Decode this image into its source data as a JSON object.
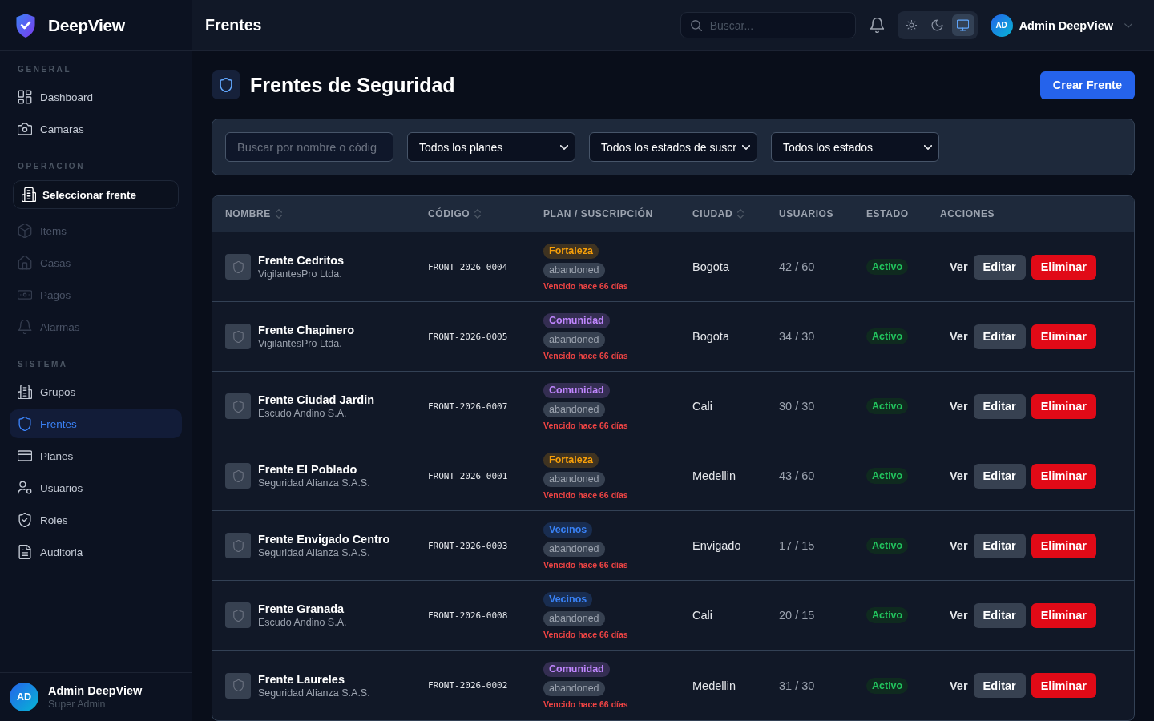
{
  "sidebar": {
    "brand": "DeepView",
    "sections": [
      {
        "title": "GENERAL",
        "items": [
          {
            "label": "Dashboard",
            "kind": "link",
            "selected": false,
            "disabled": false
          },
          {
            "label": "Camaras",
            "kind": "link",
            "selected": false,
            "disabled": false
          }
        ]
      },
      {
        "title": "OPERACION",
        "items": [
          {
            "label": "Seleccionar frente",
            "kind": "picker",
            "selected": false,
            "disabled": false
          },
          {
            "label": "Items",
            "kind": "link",
            "selected": false,
            "disabled": true
          },
          {
            "label": "Casas",
            "kind": "link",
            "selected": false,
            "disabled": true
          },
          {
            "label": "Pagos",
            "kind": "link",
            "selected": false,
            "disabled": true
          },
          {
            "label": "Alarmas",
            "kind": "link",
            "selected": false,
            "disabled": true
          }
        ]
      },
      {
        "title": "SISTEMA",
        "items": [
          {
            "label": "Grupos",
            "kind": "link",
            "selected": false,
            "disabled": false
          },
          {
            "label": "Frentes",
            "kind": "link",
            "selected": true,
            "disabled": false
          },
          {
            "label": "Planes",
            "kind": "link",
            "selected": false,
            "disabled": false
          },
          {
            "label": "Usuarios",
            "kind": "link",
            "selected": false,
            "disabled": false
          },
          {
            "label": "Roles",
            "kind": "link",
            "selected": false,
            "disabled": false
          },
          {
            "label": "Auditoria",
            "kind": "link",
            "selected": false,
            "disabled": false
          }
        ]
      }
    ],
    "user": {
      "initials": "AD",
      "name": "Admin DeepView",
      "role": "Super Admin"
    }
  },
  "header": {
    "title": "Frentes",
    "search": {
      "placeholder": "Buscar..."
    },
    "theme_options": [
      {
        "kind": "light",
        "selected": false
      },
      {
        "kind": "dark",
        "selected": false
      },
      {
        "kind": "system",
        "selected": true
      }
    ],
    "user": {
      "initials": "AD",
      "name": "Admin DeepView"
    }
  },
  "page": {
    "title": "Frentes de Seguridad",
    "primary_action": "Crear Frente"
  },
  "filters": {
    "search": {
      "placeholder": "Buscar por nombre o códig"
    },
    "selects": [
      "Todos los planes",
      "Todos los estados de suscr",
      "Todos los estados"
    ]
  },
  "table": {
    "columns": [
      {
        "label": "NOMBRE",
        "sortable": true
      },
      {
        "label": "CÓDIGO",
        "sortable": true
      },
      {
        "label": "PLAN / SUSCRIPCIÓN",
        "sortable": false
      },
      {
        "label": "CIUDAD",
        "sortable": true
      },
      {
        "label": "USUARIOS",
        "sortable": false
      },
      {
        "label": "ESTADO",
        "sortable": false
      },
      {
        "label": "ACCIONES",
        "sortable": false
      }
    ],
    "rows": [
      {
        "name": "Frente Cedritos",
        "company": "VigilantesPro Ltda.",
        "code": "FRONT-2026-0004",
        "plan": {
          "name": "Fortaleza",
          "color": "#3f3321"
        },
        "subscription": "abandoned",
        "expiry": "Vencido hace 66 días",
        "city": "Bogota",
        "users": "42 / 60",
        "status": {
          "label": "Activo",
          "kind": "active"
        },
        "actions": [
          {
            "label": "Ver",
            "kind": "view"
          },
          {
            "label": "Editar",
            "kind": "edit"
          },
          {
            "label": "Eliminar",
            "kind": "delete"
          }
        ]
      },
      {
        "name": "Frente Chapinero",
        "company": "VigilantesPro Ltda.",
        "code": "FRONT-2026-0005",
        "plan": {
          "name": "Comunidad",
          "color": "#342e52"
        },
        "subscription": "abandoned",
        "expiry": "Vencido hace 66 días",
        "city": "Bogota",
        "users": "34 / 30",
        "status": {
          "label": "Activo",
          "kind": "active"
        },
        "actions": [
          {
            "label": "Ver",
            "kind": "view"
          },
          {
            "label": "Editar",
            "kind": "edit"
          },
          {
            "label": "Eliminar",
            "kind": "delete"
          }
        ]
      },
      {
        "name": "Frente Ciudad Jardin",
        "company": "Escudo Andino S.A.",
        "code": "FRONT-2026-0007",
        "plan": {
          "name": "Comunidad",
          "color": "#342e52"
        },
        "subscription": "abandoned",
        "expiry": "Vencido hace 66 días",
        "city": "Cali",
        "users": "30 / 30",
        "status": {
          "label": "Activo",
          "kind": "active"
        },
        "actions": [
          {
            "label": "Ver",
            "kind": "view"
          },
          {
            "label": "Editar",
            "kind": "edit"
          },
          {
            "label": "Eliminar",
            "kind": "delete"
          }
        ]
      },
      {
        "name": "Frente El Poblado",
        "company": "Seguridad Alianza S.A.S.",
        "code": "FRONT-2026-0001",
        "plan": {
          "name": "Fortaleza",
          "color": "#3f3321"
        },
        "subscription": "abandoned",
        "expiry": "Vencido hace 66 días",
        "city": "Medellin",
        "users": "43 / 60",
        "status": {
          "label": "Activo",
          "kind": "active"
        },
        "actions": [
          {
            "label": "Ver",
            "kind": "view"
          },
          {
            "label": "Editar",
            "kind": "edit"
          },
          {
            "label": "Eliminar",
            "kind": "delete"
          }
        ]
      },
      {
        "name": "Frente Envigado Centro",
        "company": "Seguridad Alianza S.A.S.",
        "code": "FRONT-2026-0003",
        "plan": {
          "name": "Vecinos",
          "color": "#192d50"
        },
        "subscription": "abandoned",
        "expiry": "Vencido hace 66 días",
        "city": "Envigado",
        "users": "17 / 15",
        "status": {
          "label": "Activo",
          "kind": "active"
        },
        "actions": [
          {
            "label": "Ver",
            "kind": "view"
          },
          {
            "label": "Editar",
            "kind": "edit"
          },
          {
            "label": "Eliminar",
            "kind": "delete"
          }
        ]
      },
      {
        "name": "Frente Granada",
        "company": "Escudo Andino S.A.",
        "code": "FRONT-2026-0008",
        "plan": {
          "name": "Vecinos",
          "color": "#192d50"
        },
        "subscription": "abandoned",
        "expiry": "Vencido hace 66 días",
        "city": "Cali",
        "users": "20 / 15",
        "status": {
          "label": "Activo",
          "kind": "active"
        },
        "actions": [
          {
            "label": "Ver",
            "kind": "view"
          },
          {
            "label": "Editar",
            "kind": "edit"
          },
          {
            "label": "Eliminar",
            "kind": "delete"
          }
        ]
      },
      {
        "name": "Frente Laureles",
        "company": "Seguridad Alianza S.A.S.",
        "code": "FRONT-2026-0002",
        "plan": {
          "name": "Comunidad",
          "color": "#342e52"
        },
        "subscription": "abandoned",
        "expiry": "Vencido hace 66 días",
        "city": "Medellin",
        "users": "31 / 30",
        "status": {
          "label": "Activo",
          "kind": "active"
        },
        "actions": [
          {
            "label": "Ver",
            "kind": "view"
          },
          {
            "label": "Editar",
            "kind": "edit"
          },
          {
            "label": "Eliminar",
            "kind": "delete"
          }
        ]
      }
    ]
  }
}
